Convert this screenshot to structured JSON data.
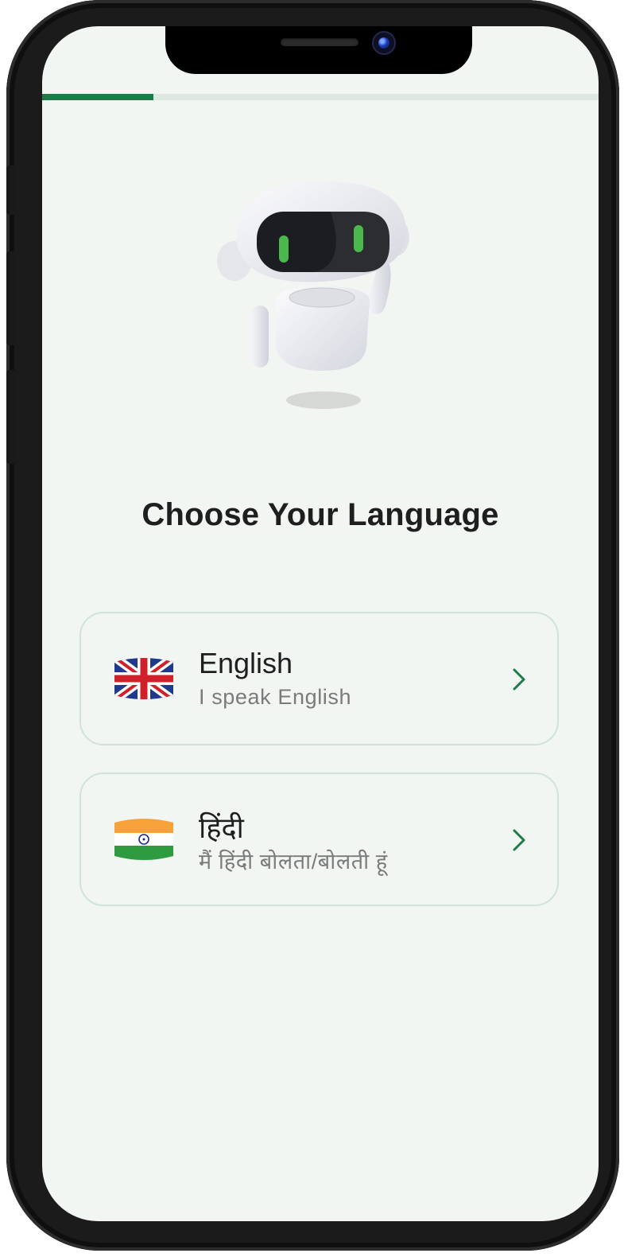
{
  "progress": {
    "value": 0.2
  },
  "screen": {
    "title": "Choose Your Language"
  },
  "languages": [
    {
      "name": "English",
      "subtitle": "I speak English",
      "flag": "uk-flag-icon"
    },
    {
      "name": "हिंदी",
      "subtitle": "मैं हिंदी बोलता/बोलती हूं",
      "flag": "india-flag-icon"
    }
  ],
  "colors": {
    "accent": "#1f7a4a",
    "background": "#f2f6f3",
    "card_border": "#cfe4d7",
    "title": "#1e1e1e",
    "subtitle": "#7a7a7a"
  },
  "icons": {
    "mascot": "robot-mascot-icon",
    "chevron": "chevron-right-icon"
  }
}
